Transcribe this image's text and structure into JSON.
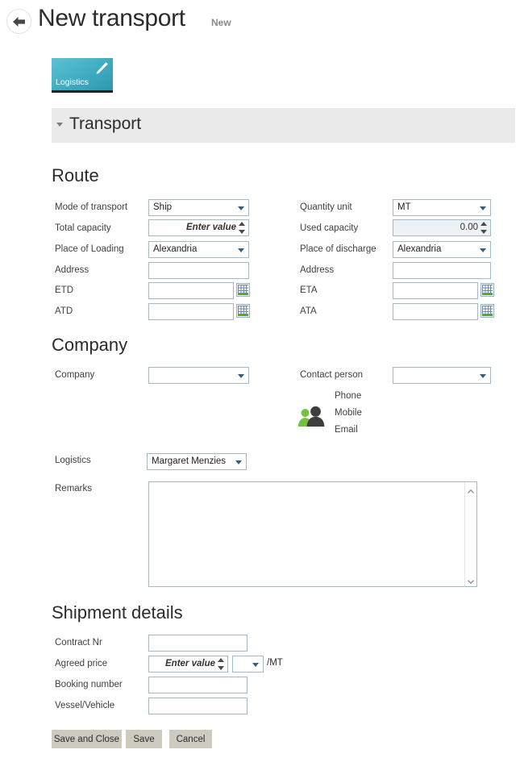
{
  "header": {
    "back_icon": "back-arrow-icon",
    "title": "New transport",
    "badge": "New"
  },
  "tab": {
    "label": "Logistics",
    "edit_icon": "pencil-icon"
  },
  "section": {
    "title": "Transport",
    "caret_icon": "caret-down-icon"
  },
  "route": {
    "heading": "Route",
    "left": {
      "mode_of_transport": {
        "label": "Mode of transport",
        "value": "Ship"
      },
      "total_capacity": {
        "label": "Total capacity",
        "placeholder": "Enter value"
      },
      "place_of_loading": {
        "label": "Place of Loading",
        "value": "Alexandria"
      },
      "address": {
        "label": "Address",
        "value": ""
      },
      "etd": {
        "label": "ETD",
        "value": ""
      },
      "atd": {
        "label": "ATD",
        "value": ""
      }
    },
    "right": {
      "quantity_unit": {
        "label": "Quantity unit",
        "value": "MT"
      },
      "used_capacity": {
        "label": "Used capacity",
        "value": "0.00"
      },
      "place_of_discharge": {
        "label": "Place of discharge",
        "value": "Alexandria"
      },
      "address": {
        "label": "Address",
        "value": ""
      },
      "eta": {
        "label": "ETA",
        "value": ""
      },
      "ata": {
        "label": "ATA",
        "value": ""
      }
    }
  },
  "company": {
    "heading": "Company",
    "company_field": {
      "label": "Company",
      "value": ""
    },
    "contact_person": {
      "label": "Contact person",
      "value": ""
    },
    "contact_details": {
      "icon": "people-icon",
      "phone_label": "Phone",
      "mobile_label": "Mobile",
      "email_label": "Email",
      "phone_value": "",
      "mobile_value": "",
      "email_value": ""
    },
    "logistics": {
      "label": "Logistics",
      "value": "Margaret Menzies"
    },
    "remarks": {
      "label": "Remarks",
      "value": ""
    }
  },
  "shipment": {
    "heading": "Shipment details",
    "contract_nr": {
      "label": "Contract Nr",
      "value": ""
    },
    "agreed_price": {
      "label": "Agreed price",
      "placeholder": "Enter value",
      "currency": "",
      "unit_suffix": "/MT"
    },
    "booking_number": {
      "label": "Booking number",
      "value": ""
    },
    "vessel_vehicle": {
      "label": "Vessel/Vehicle",
      "value": ""
    }
  },
  "actions": {
    "save_and_close": "Save and Close",
    "save": "Save",
    "cancel": "Cancel"
  },
  "colors": {
    "tab_accent": "#43b0c6",
    "band_background": "#eaeaea",
    "field_border": "#a3b8c8",
    "button_background": "#cdcbbf",
    "icon_green": "#76c043"
  }
}
